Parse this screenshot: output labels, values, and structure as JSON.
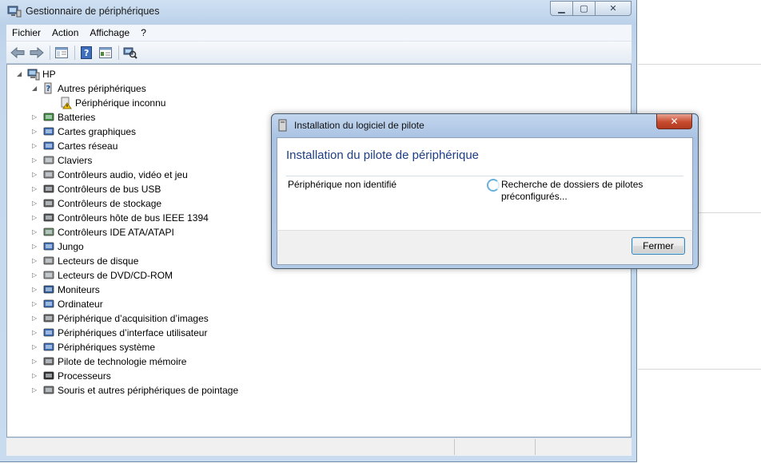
{
  "window": {
    "title": "Gestionnaire de périphériques",
    "controls": {
      "minimize": "▁",
      "maximize": "▢",
      "close": "✕"
    }
  },
  "menu": {
    "items": [
      "Fichier",
      "Action",
      "Affichage",
      "?"
    ]
  },
  "toolbar": {
    "buttons": [
      "back-arrow-icon",
      "forward-arrow-icon",
      "console-tree-icon",
      "help-icon",
      "properties-icon",
      "scan-hardware-icon"
    ]
  },
  "tree": {
    "root": "HP",
    "other_devices": "Autres périphériques",
    "unknown_device": "Périphérique inconnu",
    "categories": [
      "Batteries",
      "Cartes graphiques",
      "Cartes réseau",
      "Claviers",
      "Contrôleurs audio, vidéo et jeu",
      "Contrôleurs de bus USB",
      "Contrôleurs de stockage",
      "Contrôleurs hôte de bus IEEE 1394",
      "Contrôleurs IDE ATA/ATAPI",
      "Jungo",
      "Lecteurs de disque",
      "Lecteurs de DVD/CD-ROM",
      "Moniteurs",
      "Ordinateur",
      "Périphérique d’acquisition d’images",
      "Périphériques d’interface utilisateur",
      "Périphériques système",
      "Pilote de technologie mémoire",
      "Processeurs",
      "Souris et autres périphériques de pointage"
    ]
  },
  "dialog": {
    "title": "Installation du logiciel de pilote",
    "heading": "Installation du pilote de périphérique",
    "device": "Périphérique non identifié",
    "status_line1": "Recherche de dossiers de pilotes",
    "status_line2": "préconfigurés...",
    "close_button": "Fermer",
    "close_glyph": "✕"
  },
  "colors": {
    "heading": "#1e3e86",
    "titlebar": "#bcd2ea",
    "close_red": "#c74b2e"
  }
}
